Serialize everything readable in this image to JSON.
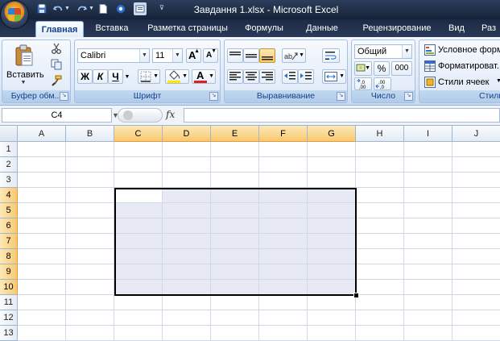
{
  "window": {
    "title": "Завдання 1.xlsx - Microsoft Excel"
  },
  "quick_access": [
    "save-icon",
    "undo-icon",
    "redo-icon",
    "new-icon",
    "open-icon",
    "print-preview-icon",
    "customize-icon"
  ],
  "tabs": [
    {
      "label": "Главная",
      "active": true
    },
    {
      "label": "Вставка",
      "active": false
    },
    {
      "label": "Разметка страницы",
      "active": false
    },
    {
      "label": "Формулы",
      "active": false
    },
    {
      "label": "Данные",
      "active": false
    },
    {
      "label": "Рецензирование",
      "active": false
    },
    {
      "label": "Вид",
      "active": false
    },
    {
      "label": "Раз",
      "active": false
    }
  ],
  "ribbon": {
    "clipboard": {
      "label": "Буфер обм...",
      "paste_label": "Вставить"
    },
    "font": {
      "label": "Шрифт",
      "font_name": "Calibri",
      "font_size": "11",
      "bold": "Ж",
      "italic": "К",
      "underline": "Ч",
      "grow_letter": "A",
      "shrink_letter": "A",
      "font_color": "#e02020",
      "highlight_color": "#ffe800"
    },
    "alignment": {
      "label": "Выравнивание"
    },
    "number": {
      "label": "Число",
      "format": "Общий",
      "percent": "%",
      "thousands": "000"
    },
    "styles": {
      "label": "Стили",
      "conditional": "Условное форм...",
      "format_table": "Форматироват...",
      "cell_styles": "Стили ячеек"
    }
  },
  "formula_bar": {
    "name_box": "C4",
    "fx": "fx",
    "value": ""
  },
  "sheet": {
    "columns": [
      "A",
      "B",
      "C",
      "D",
      "E",
      "F",
      "G",
      "H",
      "I",
      "J"
    ],
    "rows": [
      "1",
      "2",
      "3",
      "4",
      "5",
      "6",
      "7",
      "8",
      "9",
      "10",
      "11",
      "12",
      "13"
    ],
    "active_cell": "C4",
    "selection": "C4:G10",
    "selected_columns": [
      "C",
      "D",
      "E",
      "F",
      "G"
    ],
    "selected_rows": [
      "4",
      "5",
      "6",
      "7",
      "8",
      "9",
      "10"
    ],
    "selection_fill": "#e7eaf4",
    "header_highlight": "#f8c971"
  }
}
